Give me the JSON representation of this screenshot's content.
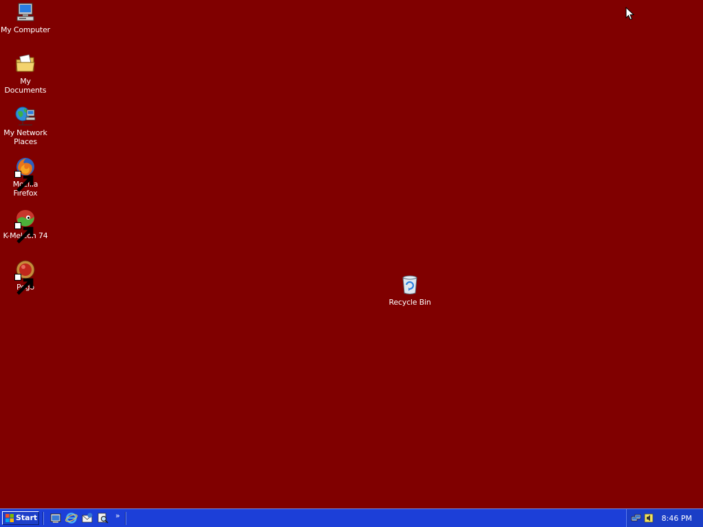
{
  "desktop": {
    "background_color": "#800000",
    "icons": [
      {
        "label": "My Computer",
        "icon": "my-computer-icon"
      },
      {
        "label": "My Documents",
        "icon": "my-documents-icon"
      },
      {
        "label": "My Network Places",
        "icon": "network-places-icon"
      },
      {
        "label": "Mozilla Firefox",
        "icon": "firefox-icon",
        "shortcut": true
      },
      {
        "label": "K-Meleon 74",
        "icon": "k-meleon-icon",
        "shortcut": true
      },
      {
        "label": "Pego",
        "icon": "pego-icon",
        "shortcut": true
      },
      {
        "label": "Recycle Bin",
        "icon": "recycle-bin-icon"
      }
    ]
  },
  "taskbar": {
    "color": "#1c3fd8",
    "start_label": "Start",
    "quick_launch": [
      {
        "icon": "show-desktop-icon"
      },
      {
        "icon": "internet-explorer-icon"
      },
      {
        "icon": "outlook-express-icon"
      },
      {
        "icon": "search-icon"
      }
    ],
    "more_label": "»",
    "tray": {
      "icons": [
        "network-tray-icon",
        "speaker-tray-icon"
      ],
      "time": "8:46 PM"
    }
  }
}
